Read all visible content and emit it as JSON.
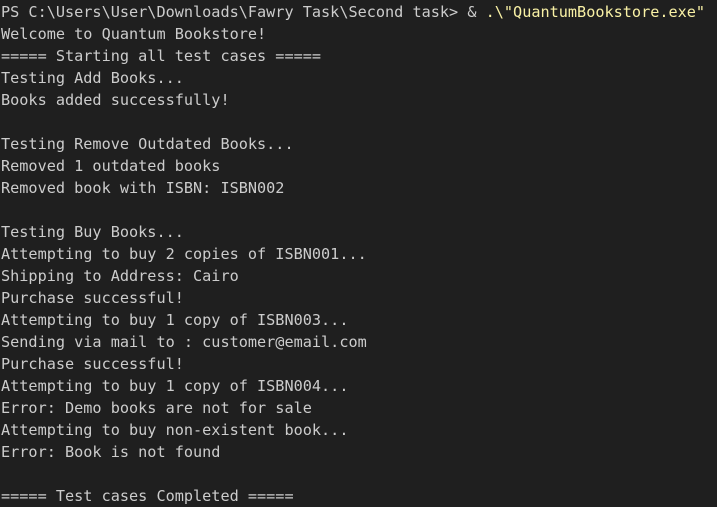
{
  "prompt": {
    "path": "PS C:\\Users\\User\\Downloads\\Fawry Task\\Second task> ",
    "operator": "& ",
    "command": ".\\\"QuantumBookstore.exe\""
  },
  "output_lines": [
    "Welcome to Quantum Bookstore!",
    "===== Starting all test cases =====",
    "Testing Add Books...",
    "Books added successfully!",
    "",
    "Testing Remove Outdated Books...",
    "Removed 1 outdated books",
    "Removed book with ISBN: ISBN002",
    "",
    "Testing Buy Books...",
    "Attempting to buy 2 copies of ISBN001...",
    "Shipping to Address: Cairo",
    "Purchase successful!",
    "Attempting to buy 1 copy of ISBN003...",
    "Sending via mail to : customer@email.com",
    "Purchase successful!",
    "Attempting to buy 1 copy of ISBN004...",
    "Error: Demo books are not for sale",
    "Attempting to buy non-existent book...",
    "Error: Book is not found",
    "",
    "===== Test cases Completed ====="
  ],
  "colors": {
    "background": "#1f1f1f",
    "text": "#cccccc",
    "command": "#f9f1a5"
  }
}
